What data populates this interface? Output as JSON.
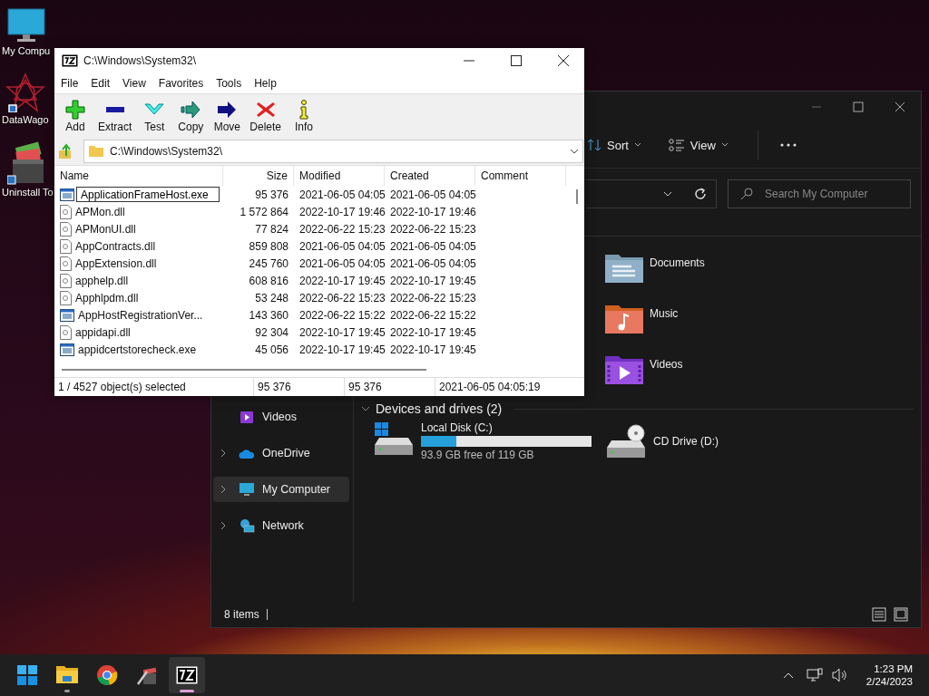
{
  "desktop_icons": [
    {
      "label": "My Compu",
      "kind": "computer"
    },
    {
      "label": "DataWago",
      "kind": "star"
    },
    {
      "label": "Uninstall To",
      "kind": "installer"
    }
  ],
  "explorer": {
    "toolbar": [
      {
        "label": "Sort",
        "kind": "sort"
      },
      {
        "label": "View",
        "kind": "view"
      }
    ],
    "search": {
      "placeholder": "Search My Computer"
    },
    "folders": [
      {
        "label": "Documents",
        "kind": "documents"
      },
      {
        "label": "Music",
        "kind": "music"
      },
      {
        "label": "Videos",
        "kind": "videos"
      }
    ],
    "nav": [
      {
        "label": "Videos",
        "kind": "videos",
        "expandable": false,
        "selected": false
      },
      {
        "label": "OneDrive",
        "kind": "cloud",
        "expandable": true,
        "selected": false
      },
      {
        "label": "My Computer",
        "kind": "computer",
        "expandable": true,
        "selected": true
      },
      {
        "label": "Network",
        "kind": "network",
        "expandable": true,
        "selected": false
      }
    ],
    "section": {
      "title": "Devices and drives (2)",
      "expanded": true
    },
    "drives": [
      {
        "label": "Local Disk (C:)",
        "kind": "disk",
        "level": 0.21,
        "free": "93.9 GB free of 119 GB"
      },
      {
        "label": "CD Drive (D:)",
        "kind": "cd"
      }
    ],
    "status": "8 items"
  },
  "sevenzip": {
    "title": "C:\\Windows\\System32\\",
    "menu": [
      "File",
      "Edit",
      "View",
      "Favorites",
      "Tools",
      "Help"
    ],
    "toolbar": [
      {
        "label": "Add",
        "kind": "add"
      },
      {
        "label": "Extract",
        "kind": "extract"
      },
      {
        "label": "Test",
        "kind": "test"
      },
      {
        "label": "Copy",
        "kind": "copy"
      },
      {
        "label": "Move",
        "kind": "move"
      },
      {
        "label": "Delete",
        "kind": "delete"
      },
      {
        "label": "Info",
        "kind": "info"
      }
    ],
    "path": "C:\\Windows\\System32\\",
    "columns": [
      "Name",
      "Size",
      "Modified",
      "Created",
      "Comment"
    ],
    "rows": [
      {
        "name": "ApplicationFrameHost.exe",
        "kind": "exe",
        "size": "95 376",
        "modified": "2021-06-05 04:05",
        "created": "2021-06-05 04:05",
        "renaming": true
      },
      {
        "name": "APMon.dll",
        "kind": "dll",
        "size": "1 572 864",
        "modified": "2022-10-17 19:46",
        "created": "2022-10-17 19:46",
        "renaming": false
      },
      {
        "name": "APMonUI.dll",
        "kind": "dll",
        "size": "77 824",
        "modified": "2022-06-22 15:23",
        "created": "2022-06-22 15:23",
        "renaming": false
      },
      {
        "name": "AppContracts.dll",
        "kind": "dll",
        "size": "859 808",
        "modified": "2021-06-05 04:05",
        "created": "2021-06-05 04:05",
        "renaming": false
      },
      {
        "name": "AppExtension.dll",
        "kind": "dll",
        "size": "245 760",
        "modified": "2021-06-05 04:05",
        "created": "2021-06-05 04:05",
        "renaming": false
      },
      {
        "name": "apphelp.dll",
        "kind": "dll",
        "size": "608 816",
        "modified": "2022-10-17 19:45",
        "created": "2022-10-17 19:45",
        "renaming": false
      },
      {
        "name": "Apphlpdm.dll",
        "kind": "dll",
        "size": "53 248",
        "modified": "2022-06-22 15:23",
        "created": "2022-06-22 15:23",
        "renaming": false
      },
      {
        "name": "AppHostRegistrationVer...",
        "kind": "exe",
        "size": "143 360",
        "modified": "2022-06-22 15:22",
        "created": "2022-06-22 15:22",
        "renaming": false
      },
      {
        "name": "appidapi.dll",
        "kind": "dll",
        "size": "92 304",
        "modified": "2022-10-17 19:45",
        "created": "2022-10-17 19:45",
        "renaming": false
      },
      {
        "name": "appidcertstorecheck.exe",
        "kind": "exe",
        "size": "45 056",
        "modified": "2022-10-17 19:45",
        "created": "2022-10-17 19:45",
        "renaming": false
      }
    ],
    "status": [
      "1 / 4527 object(s) selected",
      "95 376",
      "95 376",
      "2021-06-05 04:05:19"
    ]
  },
  "taskbar": {
    "apps": [
      {
        "kind": "start",
        "running": false,
        "active": false
      },
      {
        "kind": "explorer",
        "running": true,
        "active": false
      },
      {
        "kind": "chrome",
        "running": false,
        "active": false
      },
      {
        "kind": "tool",
        "running": false,
        "active": false
      },
      {
        "kind": "sevenzip",
        "running": true,
        "active": true
      }
    ],
    "time": "1:23 PM",
    "date": "2/24/2023"
  }
}
